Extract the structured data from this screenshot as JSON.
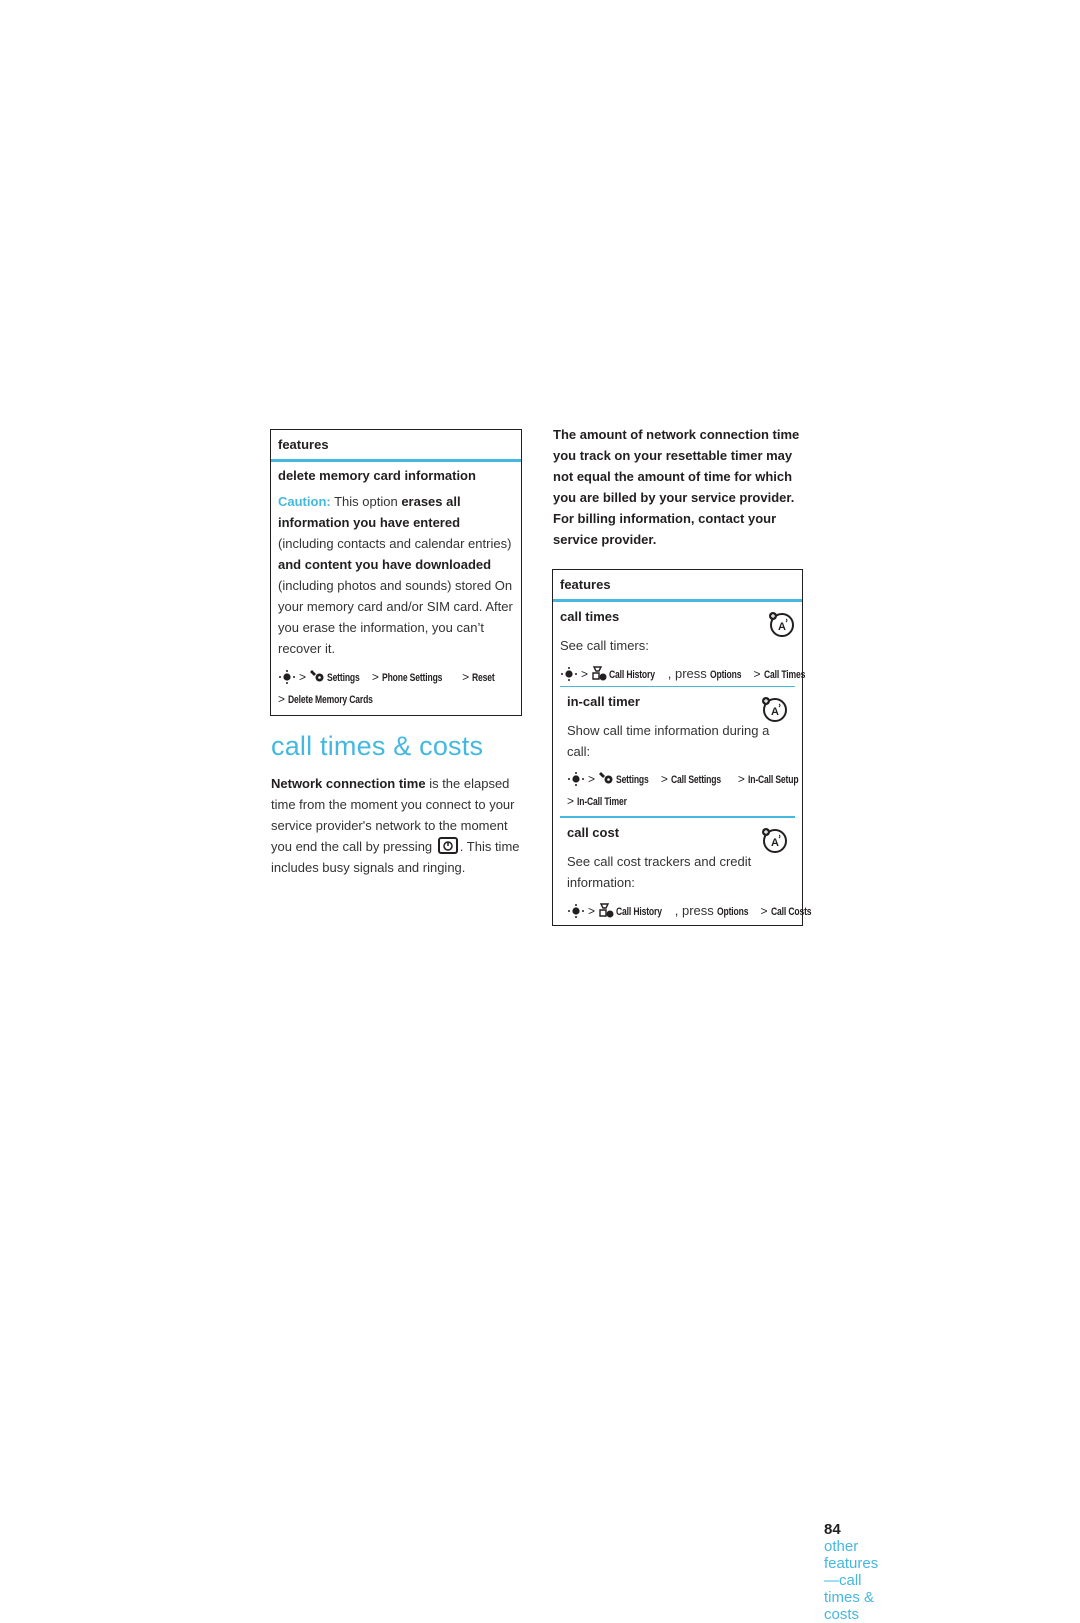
{
  "left_table": {
    "header": "features",
    "row": {
      "title": "delete memory card information",
      "caution_label": "Caution:",
      "text_1": " This option ",
      "bold_1": "erases all information you have entered",
      "text_2": " (including contacts and calendar entries) ",
      "bold_2": "and content you have downloaded",
      "text_3": " (including photos and sounds) stored On your memory card and/or SIM card. After you erase the information, you can’t recover it.",
      "path": [
        "Settings",
        "Phone Settings",
        "Reset",
        "Delete Memory Cards"
      ]
    }
  },
  "section": {
    "title": "call times & costs",
    "intro_bold": "Network connection time",
    "intro_text_1": " is the elapsed time from the moment you connect to your service provider's network to the moment you end the call by pressing ",
    "intro_key_icon": "end-key-icon",
    "intro_text_2": ". This time includes busy signals and ringing."
  },
  "note": "The amount of network connection time you track on your resettable timer may not equal the amount of time for which you are billed by your service provider. For billing information, contact your service provider.",
  "right_table": {
    "header": "features",
    "rows": [
      {
        "title": "call times",
        "desc": "See call timers:",
        "path_1": "Call History",
        "press": ", press ",
        "path_2": "Options",
        "path_3": "Call Times",
        "icon": "network-dependent-icon"
      },
      {
        "title": "in-call timer",
        "desc": "Show call time information during a call:",
        "path": [
          "Settings",
          "Call Settings",
          "In-Call Setup",
          "In-Call Timer"
        ],
        "icon": "network-dependent-icon"
      },
      {
        "title": "call cost",
        "desc": "See call cost trackers and credit information:",
        "path_1": "Call History",
        "press": ", press ",
        "path_2": "Options",
        "path_3": "Call Costs",
        "icon": "network-dependent-icon"
      }
    ]
  },
  "footer": {
    "page_number": "84",
    "running_title": "other features—call times & costs"
  },
  "colors": {
    "accent": "#45b8e0",
    "text": "#231f20"
  },
  "symbols": {
    "gt": ">"
  }
}
